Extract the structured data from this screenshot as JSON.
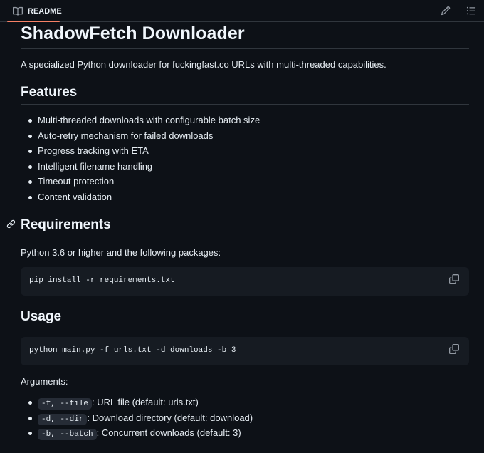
{
  "tab": {
    "label": "README"
  },
  "icons": {
    "tab": "book-icon",
    "edit": "pencil-icon",
    "outline": "list-icon",
    "anchor": "link-icon",
    "copy": "copy-icon"
  },
  "colors": {
    "background": "#0d1117",
    "code_bg": "#161b22",
    "border": "#30363d",
    "accent": "#f78166",
    "text": "#e6edf3"
  },
  "readme": {
    "title": "ShadowFetch Downloader",
    "intro": "A specialized Python downloader for fuckingfast.co URLs with multi-threaded capabilities.",
    "features": {
      "heading": "Features",
      "items": [
        "Multi-threaded downloads with configurable batch size",
        "Auto-retry mechanism for failed downloads",
        "Progress tracking with ETA",
        "Intelligent filename handling",
        "Timeout protection",
        "Content validation"
      ]
    },
    "requirements": {
      "heading": "Requirements",
      "text": "Python 3.6 or higher and the following packages:",
      "code": "pip install -r requirements.txt"
    },
    "usage": {
      "heading": "Usage",
      "code": "python main.py -f urls.txt -d downloads -b 3",
      "args_label": "Arguments:",
      "args": [
        {
          "flag": "-f, --file",
          "desc": ": URL file (default: urls.txt)"
        },
        {
          "flag": "-d, --dir",
          "desc": ": Download directory (default: download)"
        },
        {
          "flag": "-b, --batch",
          "desc": ": Concurrent downloads (default: 3)"
        }
      ]
    }
  }
}
